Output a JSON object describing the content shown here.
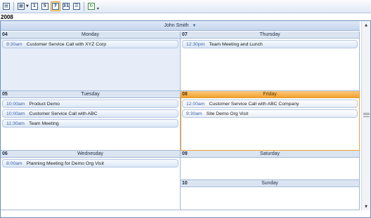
{
  "toolbar": {
    "buttons": [
      {
        "icon": "print-preview-icon",
        "label": ""
      },
      {
        "icon": "day-picker-icon",
        "label": ""
      },
      {
        "icon": "day-view-icon",
        "label": "1"
      },
      {
        "icon": "work-week-view-icon",
        "label": "5"
      },
      {
        "icon": "week-view-icon",
        "label": "7"
      },
      {
        "icon": "month-view-icon",
        "label": "31"
      },
      {
        "icon": "timeline-view-icon",
        "label": ""
      },
      {
        "icon": "refresh-icon",
        "label": ""
      }
    ]
  },
  "year": "2008",
  "owner": {
    "name": "John Smith"
  },
  "days": {
    "mon": {
      "num": "04",
      "name": "Monday",
      "appts": [
        {
          "time": "9:30am",
          "subject": "Customer Service Call with XYZ Corp"
        }
      ]
    },
    "thu": {
      "num": "07",
      "name": "Thursday",
      "appts": [
        {
          "time": "12:30pm",
          "subject": "Team Meeting and Lunch"
        }
      ]
    },
    "tue": {
      "num": "05",
      "name": "Tuesday",
      "appts": [
        {
          "time": "10:00am",
          "subject": "Product Demo"
        },
        {
          "time": "10:00am",
          "subject": "Customer Service Call with ABC"
        },
        {
          "time": "11:30am",
          "subject": "Team Meeting"
        }
      ]
    },
    "fri": {
      "num": "08",
      "name": "Friday",
      "appts": [
        {
          "time": "12:00am",
          "subject": "Customer Service Call with ABC Company"
        },
        {
          "time": "9:30am",
          "subject": "Site Demo Org Visit"
        }
      ]
    },
    "wed": {
      "num": "06",
      "name": "Wednesday",
      "appts": [
        {
          "time": "8:00am",
          "subject": "Planning Meeting for Demo Org Visit"
        }
      ]
    },
    "sat": {
      "num": "09",
      "name": "Saturday",
      "appts": []
    },
    "sun": {
      "num": "10",
      "name": "Sunday",
      "appts": []
    }
  },
  "colors": {
    "accent": "#f3a231",
    "header": "#dbe5f2",
    "tint": "#e6edf8",
    "time_text": "#3a62a8"
  }
}
